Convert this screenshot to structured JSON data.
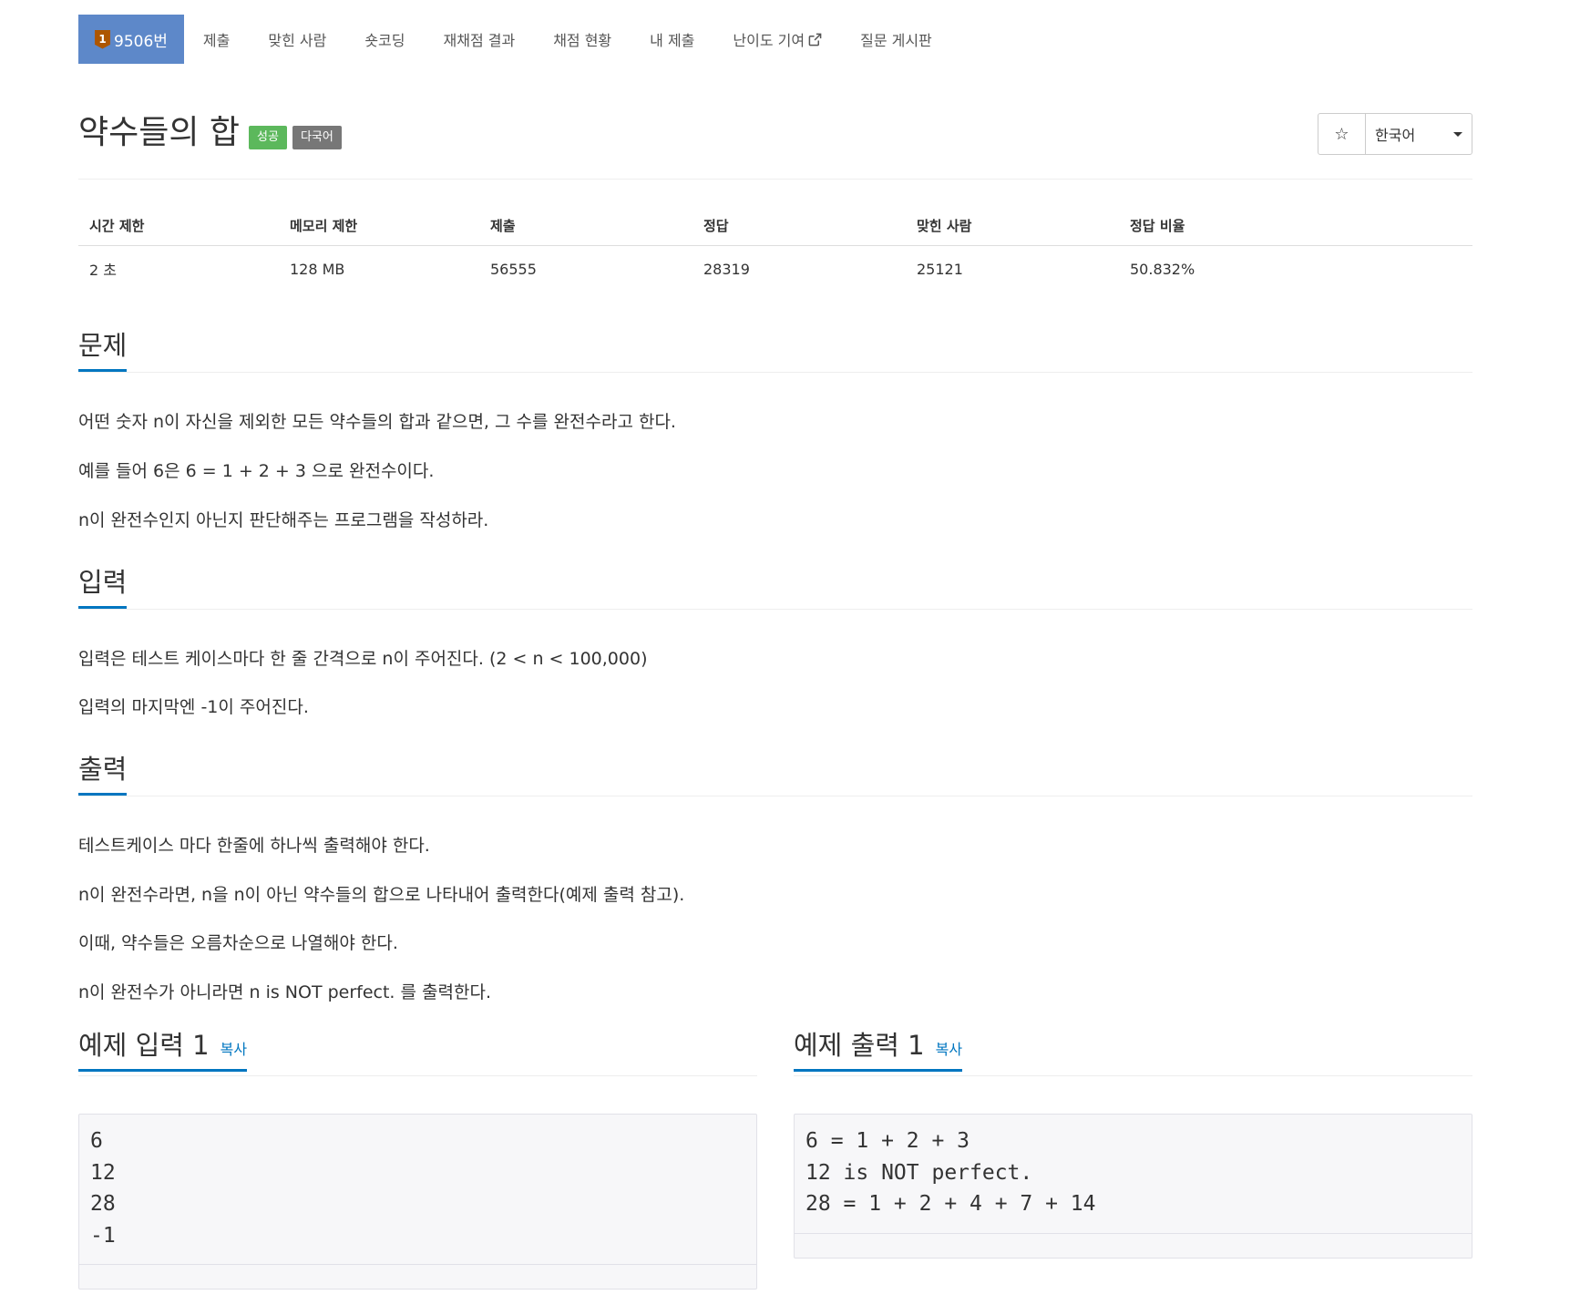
{
  "nav": {
    "problem_tier": "1",
    "problem_id": "9506번",
    "items": [
      "제출",
      "맞힌 사람",
      "숏코딩",
      "재채점 결과",
      "채점 현황",
      "내 제출",
      "난이도 기여",
      "질문 게시판"
    ]
  },
  "title": {
    "text": "약수들의 합",
    "badge_success": "성공",
    "badge_multilang": "다국어",
    "star_icon": "☆",
    "language": "한국어"
  },
  "info": {
    "headers": [
      "시간 제한",
      "메모리 제한",
      "제출",
      "정답",
      "맞힌 사람",
      "정답 비율"
    ],
    "values": [
      "2 초",
      "128 MB",
      "56555",
      "28319",
      "25121",
      "50.832%"
    ]
  },
  "problem": {
    "heading": "문제",
    "paragraphs": [
      "어떤 숫자 n이 자신을 제외한 모든 약수들의 합과 같으면, 그 수를 완전수라고 한다.",
      "예를 들어 6은 6 = 1 + 2 + 3 으로 완전수이다.",
      "n이 완전수인지 아닌지 판단해주는 프로그램을 작성하라."
    ]
  },
  "input": {
    "heading": "입력",
    "paragraphs": [
      "입력은 테스트 케이스마다 한 줄 간격으로 n이 주어진다. (2 < n < 100,000)",
      "입력의 마지막엔 -1이 주어진다."
    ]
  },
  "output": {
    "heading": "출력",
    "paragraphs": [
      "테스트케이스 마다 한줄에 하나씩 출력해야 한다.",
      "n이 완전수라면, n을 n이 아닌 약수들의 합으로 나타내어 출력한다(예제 출력 참고).",
      "이때, 약수들은 오름차순으로 나열해야 한다.",
      "n이 완전수가 아니라면 n is NOT perfect. 를 출력한다."
    ]
  },
  "sample_input": {
    "heading": "예제 입력 1",
    "copy": "복사",
    "text": "6\n12\n28\n-1"
  },
  "sample_output": {
    "heading": "예제 출력 1",
    "copy": "복사",
    "text": "6 = 1 + 2 + 3\n12 is NOT perfect.\n28 = 1 + 2 + 4 + 7 + 14"
  },
  "colors": {
    "nav_active": "#5d88c9",
    "accent": "#0076c0",
    "success": "#5cb85c",
    "default_badge": "#777777",
    "tier_bronze": "#ad5600"
  }
}
